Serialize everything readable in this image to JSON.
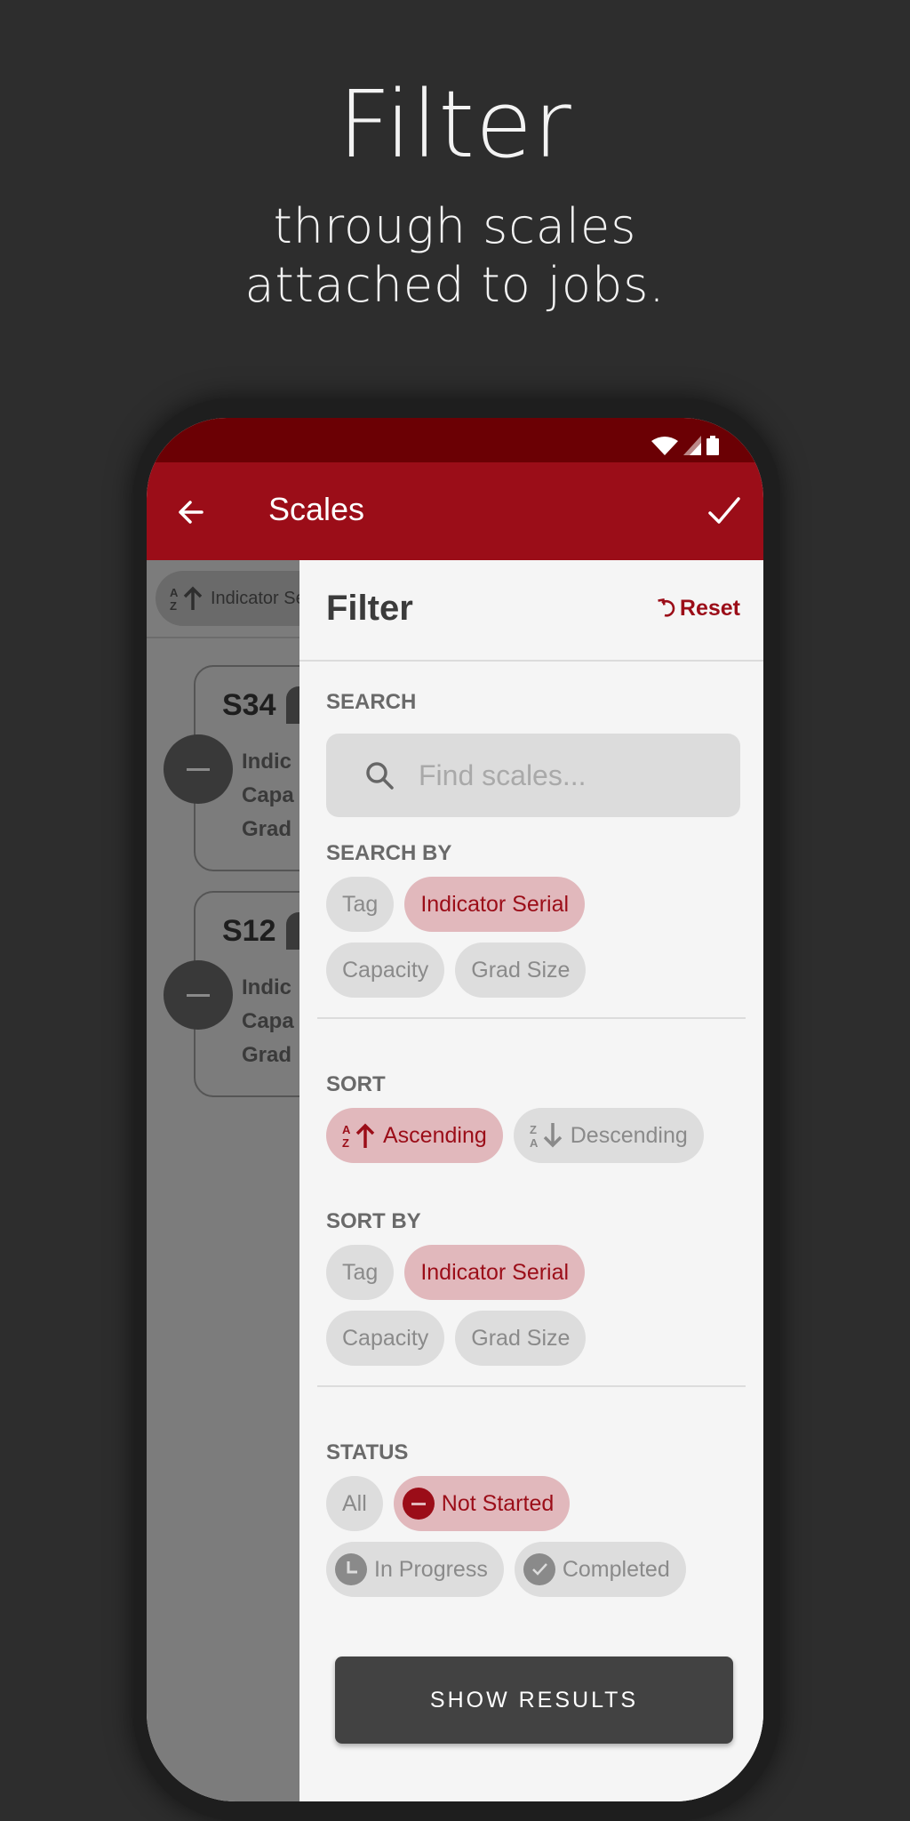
{
  "promo": {
    "title": "Filter",
    "subtitle_line1": "through scales",
    "subtitle_line2": "attached to jobs."
  },
  "status_bar": {
    "icons": [
      "wifi-icon",
      "signal-icon",
      "battery-icon"
    ]
  },
  "app_bar": {
    "title": "Scales",
    "back_icon": "arrow-left-icon",
    "confirm_icon": "check-icon",
    "color": "#9b0d18",
    "status_color": "#6b0004"
  },
  "background_list": {
    "sort_chip_label": "Indicator Serial",
    "cards": [
      {
        "title": "S34",
        "lines": [
          "Indic",
          "Capa",
          "Grad"
        ],
        "status_icon": "not-started-icon"
      },
      {
        "title": "S12",
        "lines": [
          "Indic",
          "Capa",
          "Grad"
        ],
        "status_icon": "not-started-icon"
      }
    ]
  },
  "filter": {
    "title": "Filter",
    "reset_label": "Reset",
    "search": {
      "label": "SEARCH",
      "placeholder": "Find scales...",
      "value": ""
    },
    "search_by": {
      "label": "SEARCH BY",
      "options": [
        {
          "label": "Tag",
          "selected": false
        },
        {
          "label": "Indicator Serial",
          "selected": true
        },
        {
          "label": "Capacity",
          "selected": false
        },
        {
          "label": "Grad Size",
          "selected": false
        }
      ]
    },
    "sort": {
      "label": "SORT",
      "options": [
        {
          "label": "Ascending",
          "icon": "sort-ascending-icon",
          "selected": true
        },
        {
          "label": "Descending",
          "icon": "sort-descending-icon",
          "selected": false
        }
      ]
    },
    "sort_by": {
      "label": "SORT BY",
      "options": [
        {
          "label": "Tag",
          "selected": false
        },
        {
          "label": "Indicator Serial",
          "selected": true
        },
        {
          "label": "Capacity",
          "selected": false
        },
        {
          "label": "Grad Size",
          "selected": false
        }
      ]
    },
    "status": {
      "label": "STATUS",
      "options": [
        {
          "label": "All",
          "selected": false
        },
        {
          "label": "Not Started",
          "icon": "not-started-icon",
          "selected": true
        },
        {
          "label": "In Progress",
          "icon": "clock-icon",
          "selected": false
        },
        {
          "label": "Completed",
          "icon": "check-circle-icon",
          "selected": false
        }
      ]
    },
    "show_results_label": "SHOW RESULTS"
  },
  "colors": {
    "accent": "#9b0d18",
    "chip_selected_bg": "#e1b8bc",
    "chip_bg": "#dddddd",
    "button_bg": "#424242"
  }
}
